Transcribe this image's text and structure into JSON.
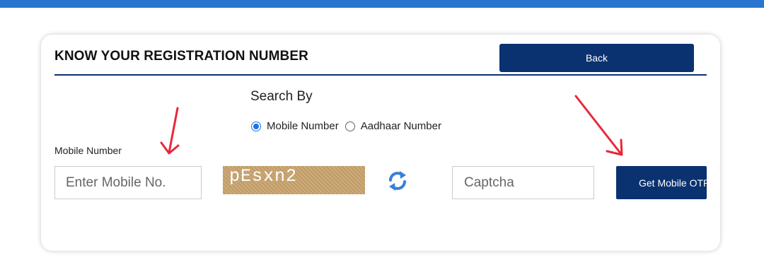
{
  "header": {
    "accent_color": "#2a75d0"
  },
  "card": {
    "title": "KNOW YOUR REGISTRATION NUMBER",
    "back_label": "Back",
    "primary_color": "#0b3270"
  },
  "search": {
    "label": "Search By",
    "options": [
      {
        "label": "Mobile Number",
        "selected": true
      },
      {
        "label": "Aadhaar Number",
        "selected": false
      }
    ]
  },
  "form": {
    "mobile_label": "Mobile Number",
    "mobile_placeholder": "Enter Mobile No.",
    "captcha_text": "pEsxn2",
    "captcha_placeholder": "Captcha",
    "submit_label": "Get Mobile OTP"
  },
  "annotations": {
    "arrow_color": "#e8283a"
  }
}
